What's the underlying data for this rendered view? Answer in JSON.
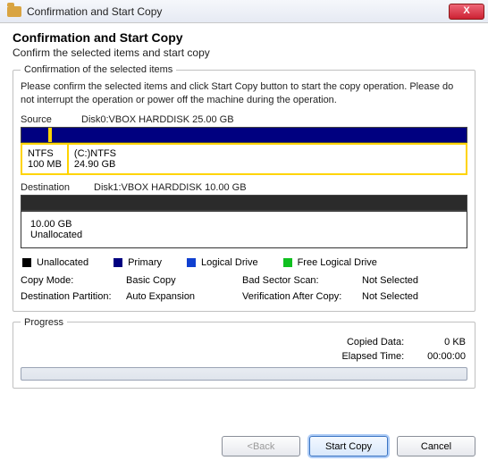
{
  "window": {
    "title": "Confirmation and Start Copy",
    "close": "X"
  },
  "header": {
    "title": "Confirmation and Start Copy",
    "subtitle": "Confirm the selected items and start copy"
  },
  "confirm_section": {
    "legend": "Confirmation of the selected items",
    "instruction": "Please confirm the selected items and click Start Copy button to start the copy operation. Please do not interrupt the operation or power off the machine during the operation.",
    "source": {
      "label": "Source",
      "disk": "Disk0:VBOX HARDDISK 25.00 GB",
      "partitions": [
        {
          "fs": "NTFS",
          "size": "100 MB"
        },
        {
          "fs": "(C:)NTFS",
          "size": "24.90 GB"
        }
      ]
    },
    "destination": {
      "label": "Destination",
      "disk": "Disk1:VBOX HARDDISK 10.00 GB",
      "partition": {
        "size": "10.00 GB",
        "state": "Unallocated"
      }
    },
    "legend_items": {
      "unallocated": "Unallocated",
      "primary": "Primary",
      "logical": "Logical Drive",
      "free_logical": "Free Logical Drive"
    },
    "settings": {
      "copy_mode_label": "Copy Mode:",
      "copy_mode_value": "Basic Copy",
      "bad_sector_label": "Bad Sector Scan:",
      "bad_sector_value": "Not Selected",
      "dest_part_label": "Destination Partition:",
      "dest_part_value": "Auto Expansion",
      "verify_label": "Verification After Copy:",
      "verify_value": "Not Selected"
    }
  },
  "progress": {
    "legend": "Progress",
    "copied_label": "Copied Data:",
    "copied_value": "0 KB",
    "elapsed_label": "Elapsed Time:",
    "elapsed_value": "00:00:00"
  },
  "buttons": {
    "back": "<Back",
    "start": "Start Copy",
    "cancel": "Cancel"
  }
}
